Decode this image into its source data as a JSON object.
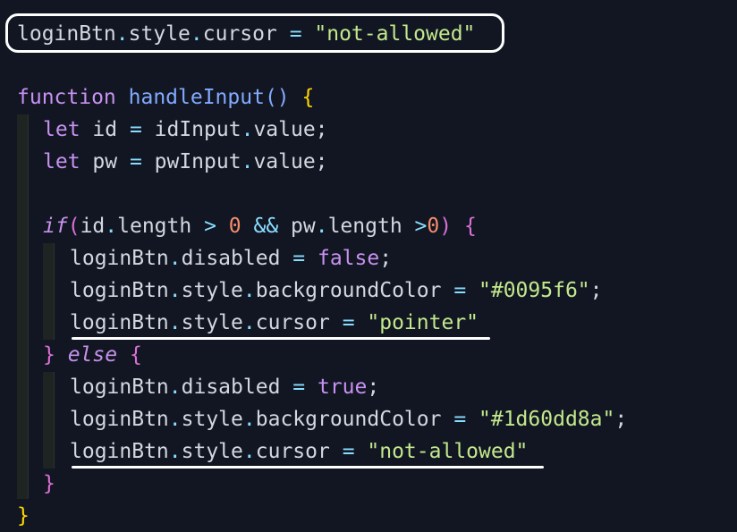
{
  "code": {
    "lines": [
      {
        "tokens": [
          {
            "text": "loginBtn",
            "kind": "plain"
          },
          {
            "text": ".",
            "kind": "op"
          },
          {
            "text": "style",
            "kind": "plain"
          },
          {
            "text": ".",
            "kind": "op"
          },
          {
            "text": "cursor ",
            "kind": "plain"
          },
          {
            "text": "= ",
            "kind": "op"
          },
          {
            "text": "\"not-allowed\"",
            "kind": "str"
          }
        ]
      },
      {
        "tokens": [
          {
            "text": "function ",
            "kind": "kw"
          },
          {
            "text": "handleInput",
            "kind": "fn"
          },
          {
            "text": "() ",
            "kind": "fn"
          },
          {
            "text": "{",
            "kind": "paren"
          }
        ]
      },
      {
        "tokens": [
          {
            "text": "let ",
            "kind": "kw"
          },
          {
            "text": "id ",
            "kind": "plain"
          },
          {
            "text": "= ",
            "kind": "op"
          },
          {
            "text": "idInput",
            "kind": "plain"
          },
          {
            "text": ".",
            "kind": "op"
          },
          {
            "text": "value;",
            "kind": "plain"
          }
        ]
      },
      {
        "tokens": [
          {
            "text": "let ",
            "kind": "kw"
          },
          {
            "text": "pw ",
            "kind": "plain"
          },
          {
            "text": "= ",
            "kind": "op"
          },
          {
            "text": "pwInput",
            "kind": "plain"
          },
          {
            "text": ".",
            "kind": "op"
          },
          {
            "text": "value;",
            "kind": "plain"
          }
        ]
      },
      {
        "tokens": []
      },
      {
        "tokens": [
          {
            "text": "if",
            "kind": "ctl"
          },
          {
            "text": "(",
            "kind": "brace"
          },
          {
            "text": "id",
            "kind": "plain"
          },
          {
            "text": ".",
            "kind": "op"
          },
          {
            "text": "length ",
            "kind": "plain"
          },
          {
            "text": "> ",
            "kind": "op"
          },
          {
            "text": "0 ",
            "kind": "num"
          },
          {
            "text": "&& ",
            "kind": "op"
          },
          {
            "text": "pw",
            "kind": "plain"
          },
          {
            "text": ".",
            "kind": "op"
          },
          {
            "text": "length ",
            "kind": "plain"
          },
          {
            "text": ">",
            "kind": "op"
          },
          {
            "text": "0",
            "kind": "num"
          },
          {
            "text": ") ",
            "kind": "brace"
          },
          {
            "text": "{",
            "kind": "brace"
          }
        ]
      },
      {
        "tokens": [
          {
            "text": "loginBtn",
            "kind": "plain"
          },
          {
            "text": ".",
            "kind": "op"
          },
          {
            "text": "disabled ",
            "kind": "plain"
          },
          {
            "text": "= ",
            "kind": "op"
          },
          {
            "text": "false",
            "kind": "kw"
          },
          {
            "text": ";",
            "kind": "plain"
          }
        ]
      },
      {
        "tokens": [
          {
            "text": "loginBtn",
            "kind": "plain"
          },
          {
            "text": ".",
            "kind": "op"
          },
          {
            "text": "style",
            "kind": "plain"
          },
          {
            "text": ".",
            "kind": "op"
          },
          {
            "text": "backgroundColor ",
            "kind": "plain"
          },
          {
            "text": "= ",
            "kind": "op"
          },
          {
            "text": "\"#0095f6\"",
            "kind": "str"
          },
          {
            "text": ";",
            "kind": "plain"
          }
        ]
      },
      {
        "tokens": [
          {
            "text": "loginBtn",
            "kind": "plain"
          },
          {
            "text": ".",
            "kind": "op"
          },
          {
            "text": "style",
            "kind": "plain"
          },
          {
            "text": ".",
            "kind": "op"
          },
          {
            "text": "cursor ",
            "kind": "plain"
          },
          {
            "text": "= ",
            "kind": "op"
          },
          {
            "text": "\"pointer\"",
            "kind": "str"
          }
        ]
      },
      {
        "tokens": [
          {
            "text": "} ",
            "kind": "brace"
          },
          {
            "text": "else ",
            "kind": "ctl"
          },
          {
            "text": "{",
            "kind": "brace"
          }
        ]
      },
      {
        "tokens": [
          {
            "text": "loginBtn",
            "kind": "plain"
          },
          {
            "text": ".",
            "kind": "op"
          },
          {
            "text": "disabled ",
            "kind": "plain"
          },
          {
            "text": "= ",
            "kind": "op"
          },
          {
            "text": "true",
            "kind": "kw"
          },
          {
            "text": ";",
            "kind": "plain"
          }
        ]
      },
      {
        "tokens": [
          {
            "text": "loginBtn",
            "kind": "plain"
          },
          {
            "text": ".",
            "kind": "op"
          },
          {
            "text": "style",
            "kind": "plain"
          },
          {
            "text": ".",
            "kind": "op"
          },
          {
            "text": "backgroundColor ",
            "kind": "plain"
          },
          {
            "text": "= ",
            "kind": "op"
          },
          {
            "text": "\"#1d60dd8a\"",
            "kind": "str"
          },
          {
            "text": ";",
            "kind": "plain"
          }
        ]
      },
      {
        "tokens": [
          {
            "text": "loginBtn",
            "kind": "plain"
          },
          {
            "text": ".",
            "kind": "op"
          },
          {
            "text": "style",
            "kind": "plain"
          },
          {
            "text": ".",
            "kind": "op"
          },
          {
            "text": "cursor ",
            "kind": "plain"
          },
          {
            "text": "= ",
            "kind": "op"
          },
          {
            "text": "\"not-allowed\"",
            "kind": "str"
          }
        ]
      },
      {
        "tokens": [
          {
            "text": "}",
            "kind": "brace"
          }
        ]
      },
      {
        "tokens": [
          {
            "text": "}",
            "kind": "paren"
          }
        ]
      }
    ]
  },
  "colors": {
    "background": "#111622",
    "annotation": "#ffffff"
  }
}
